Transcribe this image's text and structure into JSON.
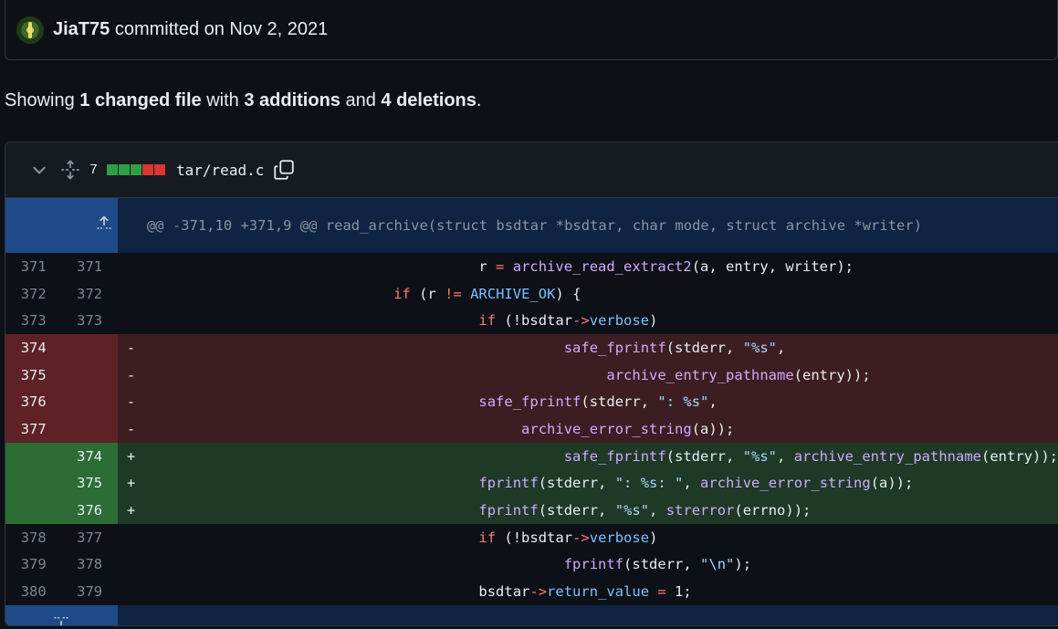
{
  "commit": {
    "author": "JiaT75",
    "action": " committed on Nov 2, 2021"
  },
  "summary": {
    "prefix": "Showing ",
    "files": "1 changed file",
    "mid1": " with ",
    "additions": "3 additions",
    "mid2": " and ",
    "deletions": "4 deletions",
    "suffix": "."
  },
  "file": {
    "change_count": "7",
    "path": "tar/read.c",
    "diffstat_colors": [
      "#2ea043",
      "#2ea043",
      "#2ea043",
      "#da3633",
      "#da3633"
    ]
  },
  "hunk_header": "@@ -371,10 +371,9 @@ read_archive(struct bsdtar *bsdtar, char mode, struct archive *writer)",
  "lines": [
    {
      "type": "ctx",
      "old": "371",
      "new": "371",
      "sign": "",
      "code": "                                        r = archive_read_extract2(a, entry, writer);"
    },
    {
      "type": "ctx",
      "old": "372",
      "new": "372",
      "sign": "",
      "code": "                              if (r != ARCHIVE_OK) {"
    },
    {
      "type": "ctx",
      "old": "373",
      "new": "373",
      "sign": "",
      "code": "                                        if (!bsdtar->verbose)"
    },
    {
      "type": "del",
      "old": "374",
      "new": "",
      "sign": "-",
      "code": "                                                  safe_fprintf(stderr, \"%s\","
    },
    {
      "type": "del",
      "old": "375",
      "new": "",
      "sign": "-",
      "code": "                                                       archive_entry_pathname(entry));"
    },
    {
      "type": "del",
      "old": "376",
      "new": "",
      "sign": "-",
      "code": "                                        safe_fprintf(stderr, \": %s\","
    },
    {
      "type": "del",
      "old": "377",
      "new": "",
      "sign": "-",
      "code": "                                             archive_error_string(a));"
    },
    {
      "type": "add",
      "old": "",
      "new": "374",
      "sign": "+",
      "code": "                                                  safe_fprintf(stderr, \"%s\", archive_entry_pathname(entry));"
    },
    {
      "type": "add",
      "old": "",
      "new": "375",
      "sign": "+",
      "code": "                                        fprintf(stderr, \": %s: \", archive_error_string(a));"
    },
    {
      "type": "add",
      "old": "",
      "new": "376",
      "sign": "+",
      "code": "                                        fprintf(stderr, \"%s\", strerror(errno));"
    },
    {
      "type": "ctx",
      "old": "378",
      "new": "377",
      "sign": "",
      "code": "                                        if (!bsdtar->verbose)"
    },
    {
      "type": "ctx",
      "old": "379",
      "new": "378",
      "sign": "",
      "code": "                                                  fprintf(stderr, \"\\n\");"
    },
    {
      "type": "ctx",
      "old": "380",
      "new": "379",
      "sign": "",
      "code": "                                        bsdtar->return_value = 1;"
    }
  ]
}
